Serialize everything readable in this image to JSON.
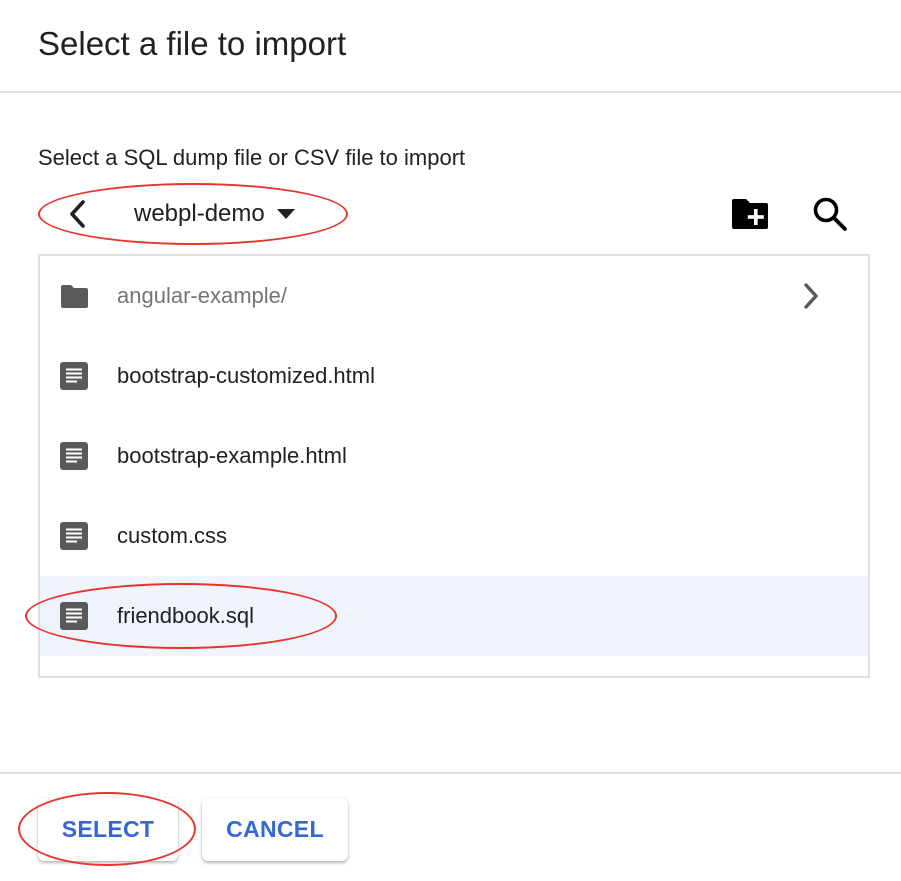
{
  "dialog": {
    "title": "Select a file to import",
    "subtitle": "Select a SQL dump file or CSV file to import"
  },
  "navigation": {
    "back_icon": "chevron-left-icon",
    "bucket_name": "webpl-demo",
    "dropdown_icon": "caret-down-icon",
    "new_folder_icon": "create-new-folder-icon",
    "search_icon": "search-icon"
  },
  "files": [
    {
      "name": "angular-example/",
      "type": "folder",
      "icon": "folder-icon",
      "has_chevron": true,
      "selected": false
    },
    {
      "name": "bootstrap-customized.html",
      "type": "file",
      "icon": "document-icon",
      "selected": false
    },
    {
      "name": "bootstrap-example.html",
      "type": "file",
      "icon": "document-icon",
      "selected": false
    },
    {
      "name": "custom.css",
      "type": "file",
      "icon": "document-icon",
      "selected": false
    },
    {
      "name": "friendbook.sql",
      "type": "file",
      "icon": "document-icon",
      "selected": true
    }
  ],
  "actions": {
    "select_label": "SELECT",
    "cancel_label": "CANCEL"
  },
  "colors": {
    "accent": "#3367d6",
    "selected_row": "#eff4fd",
    "annotation": "#e8352b",
    "icon_gray": "#5f6368"
  }
}
